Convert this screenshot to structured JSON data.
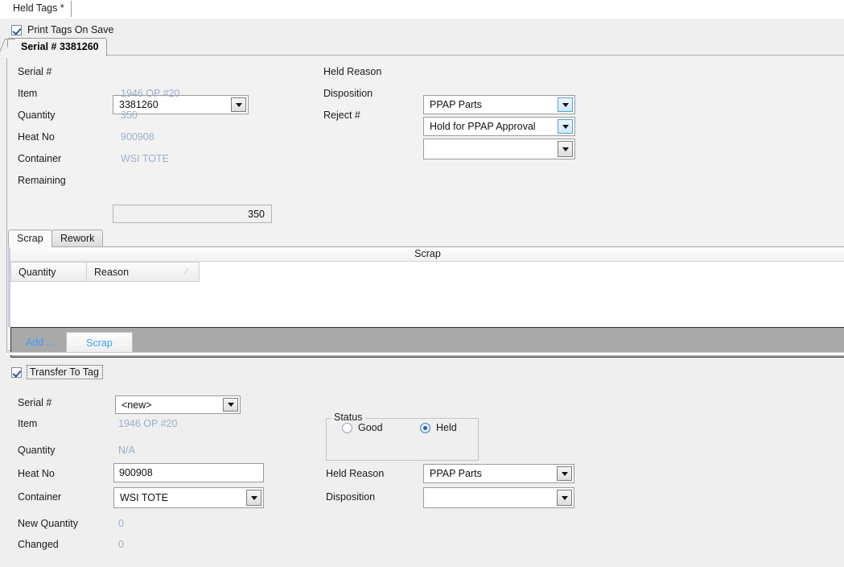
{
  "window": {
    "tab_label": "Held Tags *"
  },
  "print_tags": {
    "label": "Print Tags On Save",
    "checked": true
  },
  "serial_panel": {
    "tab_title": "Serial # 3381260",
    "left_fields": {
      "serial_label": "Serial #",
      "serial_value": "3381260",
      "item_label": "Item",
      "item_value": "1946 OP #20",
      "quantity_label": "Quantity",
      "quantity_value": "350",
      "heat_label": "Heat No",
      "heat_value": "900908",
      "container_label": "Container",
      "container_value": "WSI TOTE",
      "remaining_label": "Remaining",
      "remaining_value": "350"
    },
    "right_fields": {
      "held_reason_label": "Held Reason",
      "held_reason_value": "PPAP Parts",
      "disposition_label": "Disposition",
      "disposition_value": "Hold for PPAP Approval",
      "reject_label": "Reject #",
      "reject_value": ""
    },
    "inner_tabs": {
      "scrap": "Scrap",
      "rework": "Rework"
    },
    "grid": {
      "caption": "Scrap",
      "columns": [
        "Quantity",
        "Reason"
      ],
      "sort_indicator": "⁄",
      "rows": []
    },
    "toolbar": {
      "add_label": "Add ...",
      "scrap_label": "Scrap"
    }
  },
  "transfer": {
    "checkbox_label": "Transfer To Tag",
    "checked": true,
    "serial_label": "Serial #",
    "serial_value": "<new>",
    "item_label": "Item",
    "item_value": "1946 OP #20",
    "quantity_label": "Quantity",
    "quantity_value": "N/A",
    "heat_label": "Heat No",
    "heat_value": "900908",
    "container_label": "Container",
    "container_value": "WSI TOTE",
    "new_quantity_label": "New Quantity",
    "new_quantity_value": "0",
    "changed_label": "Changed",
    "changed_value": "0",
    "status": {
      "title": "Status",
      "good_label": "Good",
      "held_label": "Held",
      "selected": "Held"
    },
    "held_reason_label": "Held Reason",
    "held_reason_value": "PPAP Parts",
    "disposition_label": "Disposition",
    "disposition_value": ""
  },
  "colors": {
    "readonly_text": "#9aafc9",
    "link_blue": "#3e9bfd",
    "toolbar_grey": "#a9a9a9",
    "panel_bg": "#efefef"
  }
}
